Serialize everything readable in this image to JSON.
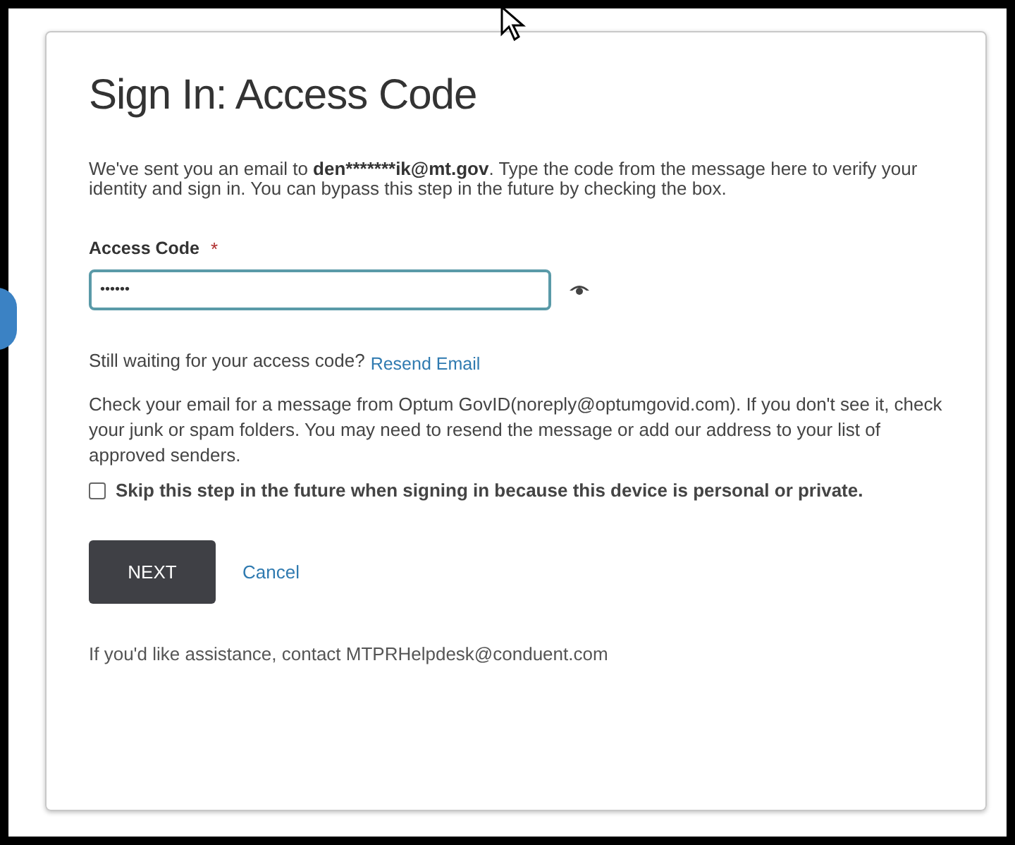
{
  "title": "Sign In: Access Code",
  "intro": {
    "before": "We've sent you an email to ",
    "email": "den*******ik@mt.gov",
    "after": ". Type the code from the message here to verify your identity and sign in. You can bypass this step in the future by checking the box."
  },
  "access_code": {
    "label": "Access Code",
    "required_mark": "*",
    "value": "••••••"
  },
  "waiting": {
    "text": "Still waiting for your access code?",
    "link": "Resend Email"
  },
  "check_note": "Check your email for a message from Optum GovID(noreply@optumgovid.com). If you don't see it, check your junk or spam folders. You may need to resend the message or add our address to your list of approved senders.",
  "skip": {
    "label": "Skip this step in the future when signing in because this device is personal or private.",
    "checked": false
  },
  "buttons": {
    "next": "NEXT",
    "cancel": "Cancel"
  },
  "assistance": "If you'd like assistance, contact MTPRHelpdesk@conduent.com"
}
